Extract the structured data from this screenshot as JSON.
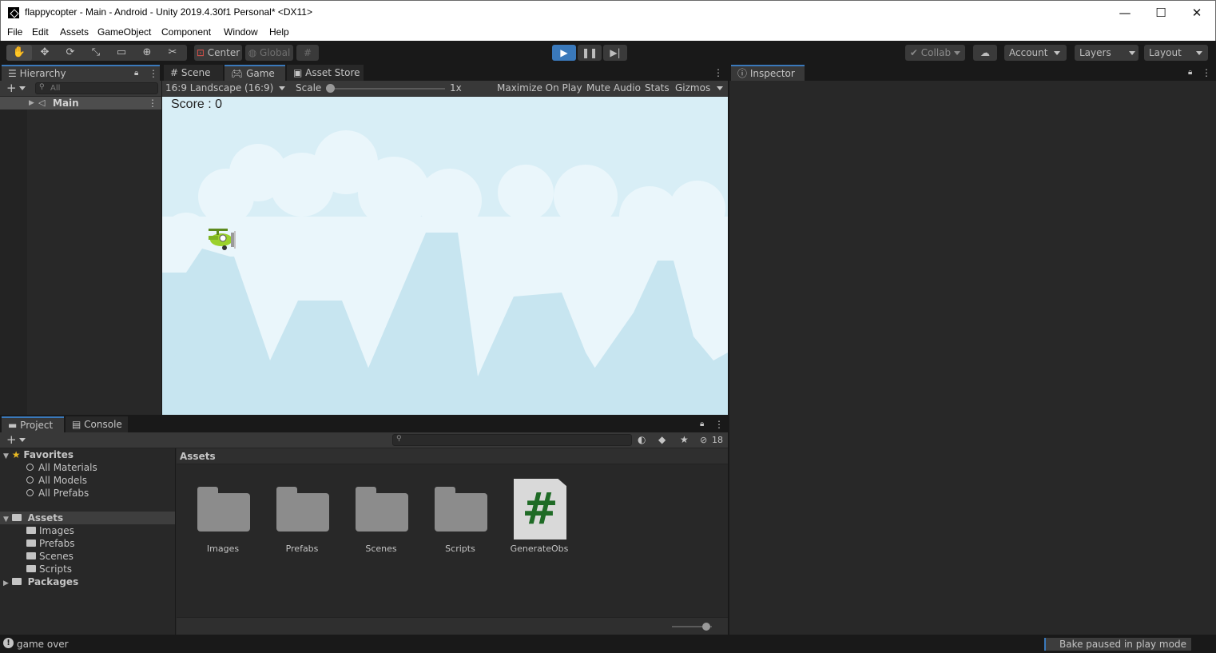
{
  "window": {
    "title": "flappycopter - Main - Android - Unity 2019.4.30f1 Personal* <DX11>",
    "minimize": "—",
    "maximize": "☐",
    "close": "✕"
  },
  "menu": [
    "File",
    "Edit",
    "Assets",
    "GameObject",
    "Component",
    "Window",
    "Help"
  ],
  "toolbar": {
    "pivot_mode": "Center",
    "pivot_rotation": "Global",
    "collab": "Collab",
    "account": "Account",
    "layers": "Layers",
    "layout": "Layout"
  },
  "hierarchy": {
    "tab": "Hierarchy",
    "search_placeholder": "All",
    "scene_name": "Main"
  },
  "scene_tabs": {
    "scene": "Scene",
    "game": "Game",
    "asset_store": "Asset Store"
  },
  "game_toolbar": {
    "aspect": "16:9 Landscape (16:9)",
    "scale_label": "Scale",
    "scale_value": "1x",
    "maximize_on_play": "Maximize On Play",
    "mute_audio": "Mute Audio",
    "stats": "Stats",
    "gizmos": "Gizmos"
  },
  "game_view": {
    "score_text": "Score : 0",
    "sky_color": "#d8eef6",
    "cloud_color": "#eaf6fb",
    "mountain_color": "#c7e5f0"
  },
  "inspector": {
    "tab": "Inspector"
  },
  "project": {
    "tab_project": "Project",
    "tab_console": "Console",
    "hidden_count": "18",
    "favorites_label": "Favorites",
    "favorites": [
      "All Materials",
      "All Models",
      "All Prefabs"
    ],
    "assets_label": "Assets",
    "asset_folders": [
      "Images",
      "Prefabs",
      "Scenes",
      "Scripts"
    ],
    "packages_label": "Packages",
    "breadcrumb": "Assets",
    "grid_items": [
      {
        "name": "Images",
        "type": "folder"
      },
      {
        "name": "Prefabs",
        "type": "folder"
      },
      {
        "name": "Scenes",
        "type": "folder"
      },
      {
        "name": "Scripts",
        "type": "folder"
      },
      {
        "name": "GenerateObs",
        "type": "csharp-script"
      }
    ],
    "script_glyph": "#"
  },
  "status": {
    "message": "game over",
    "bake": "Bake paused in play mode"
  },
  "colors": {
    "accent": "#3a79bb",
    "panel_bg": "#282828",
    "header_bg": "#383838",
    "text": "#c4c4c4",
    "script_green": "#1f6b26"
  }
}
